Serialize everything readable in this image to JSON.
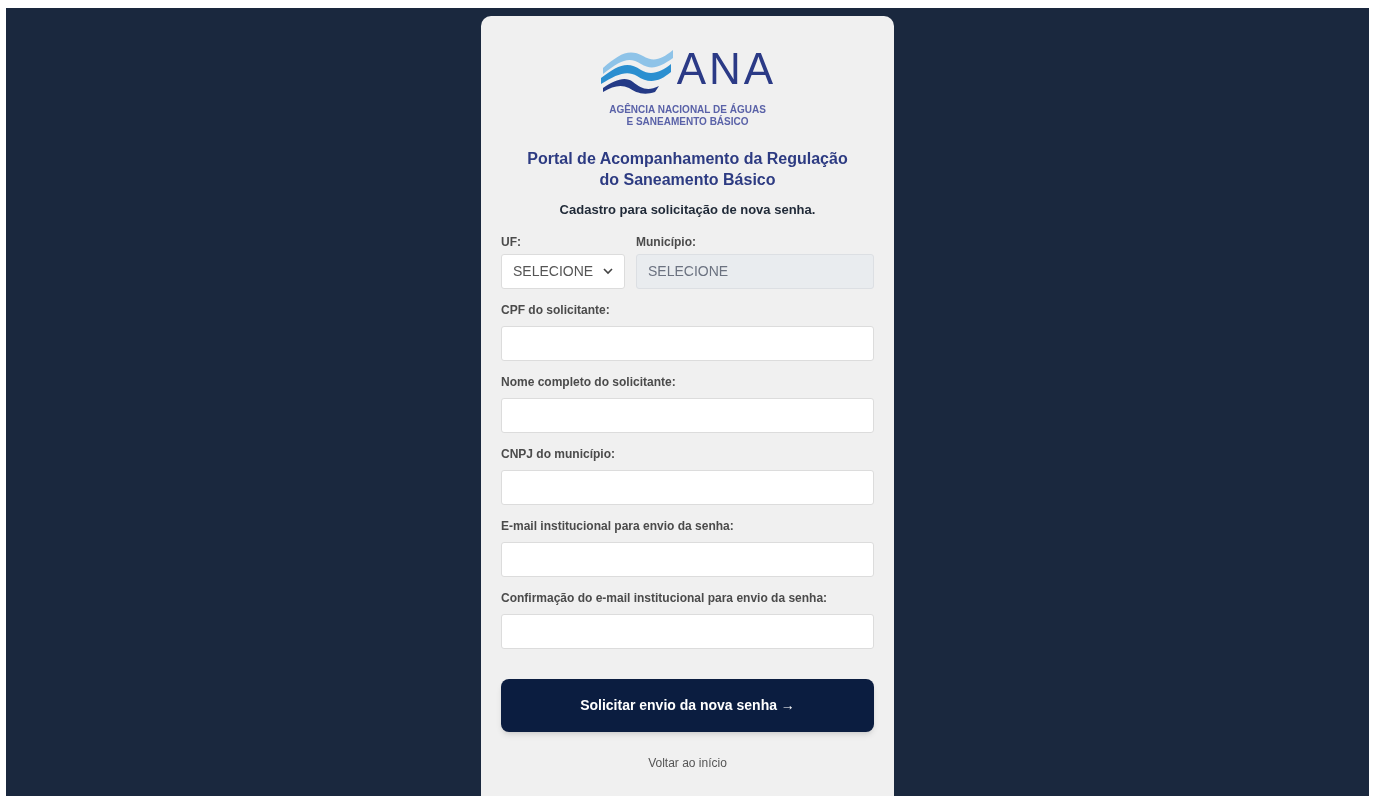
{
  "logo": {
    "acronym": "ANA",
    "subtitle_lines": [
      "AGÊNCIA NACIONAL DE ÁGUAS",
      "E SANEAMENTO BÁSICO"
    ]
  },
  "title_lines": [
    "Portal de Acompanhamento da Regulação",
    "do Saneamento Básico"
  ],
  "subtitle": "Cadastro para solicitação de nova senha.",
  "selects": [
    {
      "label": "UF:",
      "value": "SELECIONE",
      "disabled": false
    },
    {
      "label": "Município:",
      "value": "SELECIONE",
      "disabled": true
    }
  ],
  "fields": [
    {
      "label": "CPF do solicitante:"
    },
    {
      "label": "Nome completo do solicitante:"
    },
    {
      "label": "CNPJ do município:"
    },
    {
      "label": "E-mail institucional para envio da senha:"
    },
    {
      "label": "Confirmação do e-mail institucional para envio da senha:"
    }
  ],
  "submit_button": "Solicitar envio da nova senha →",
  "back_link": "Voltar ao início"
}
